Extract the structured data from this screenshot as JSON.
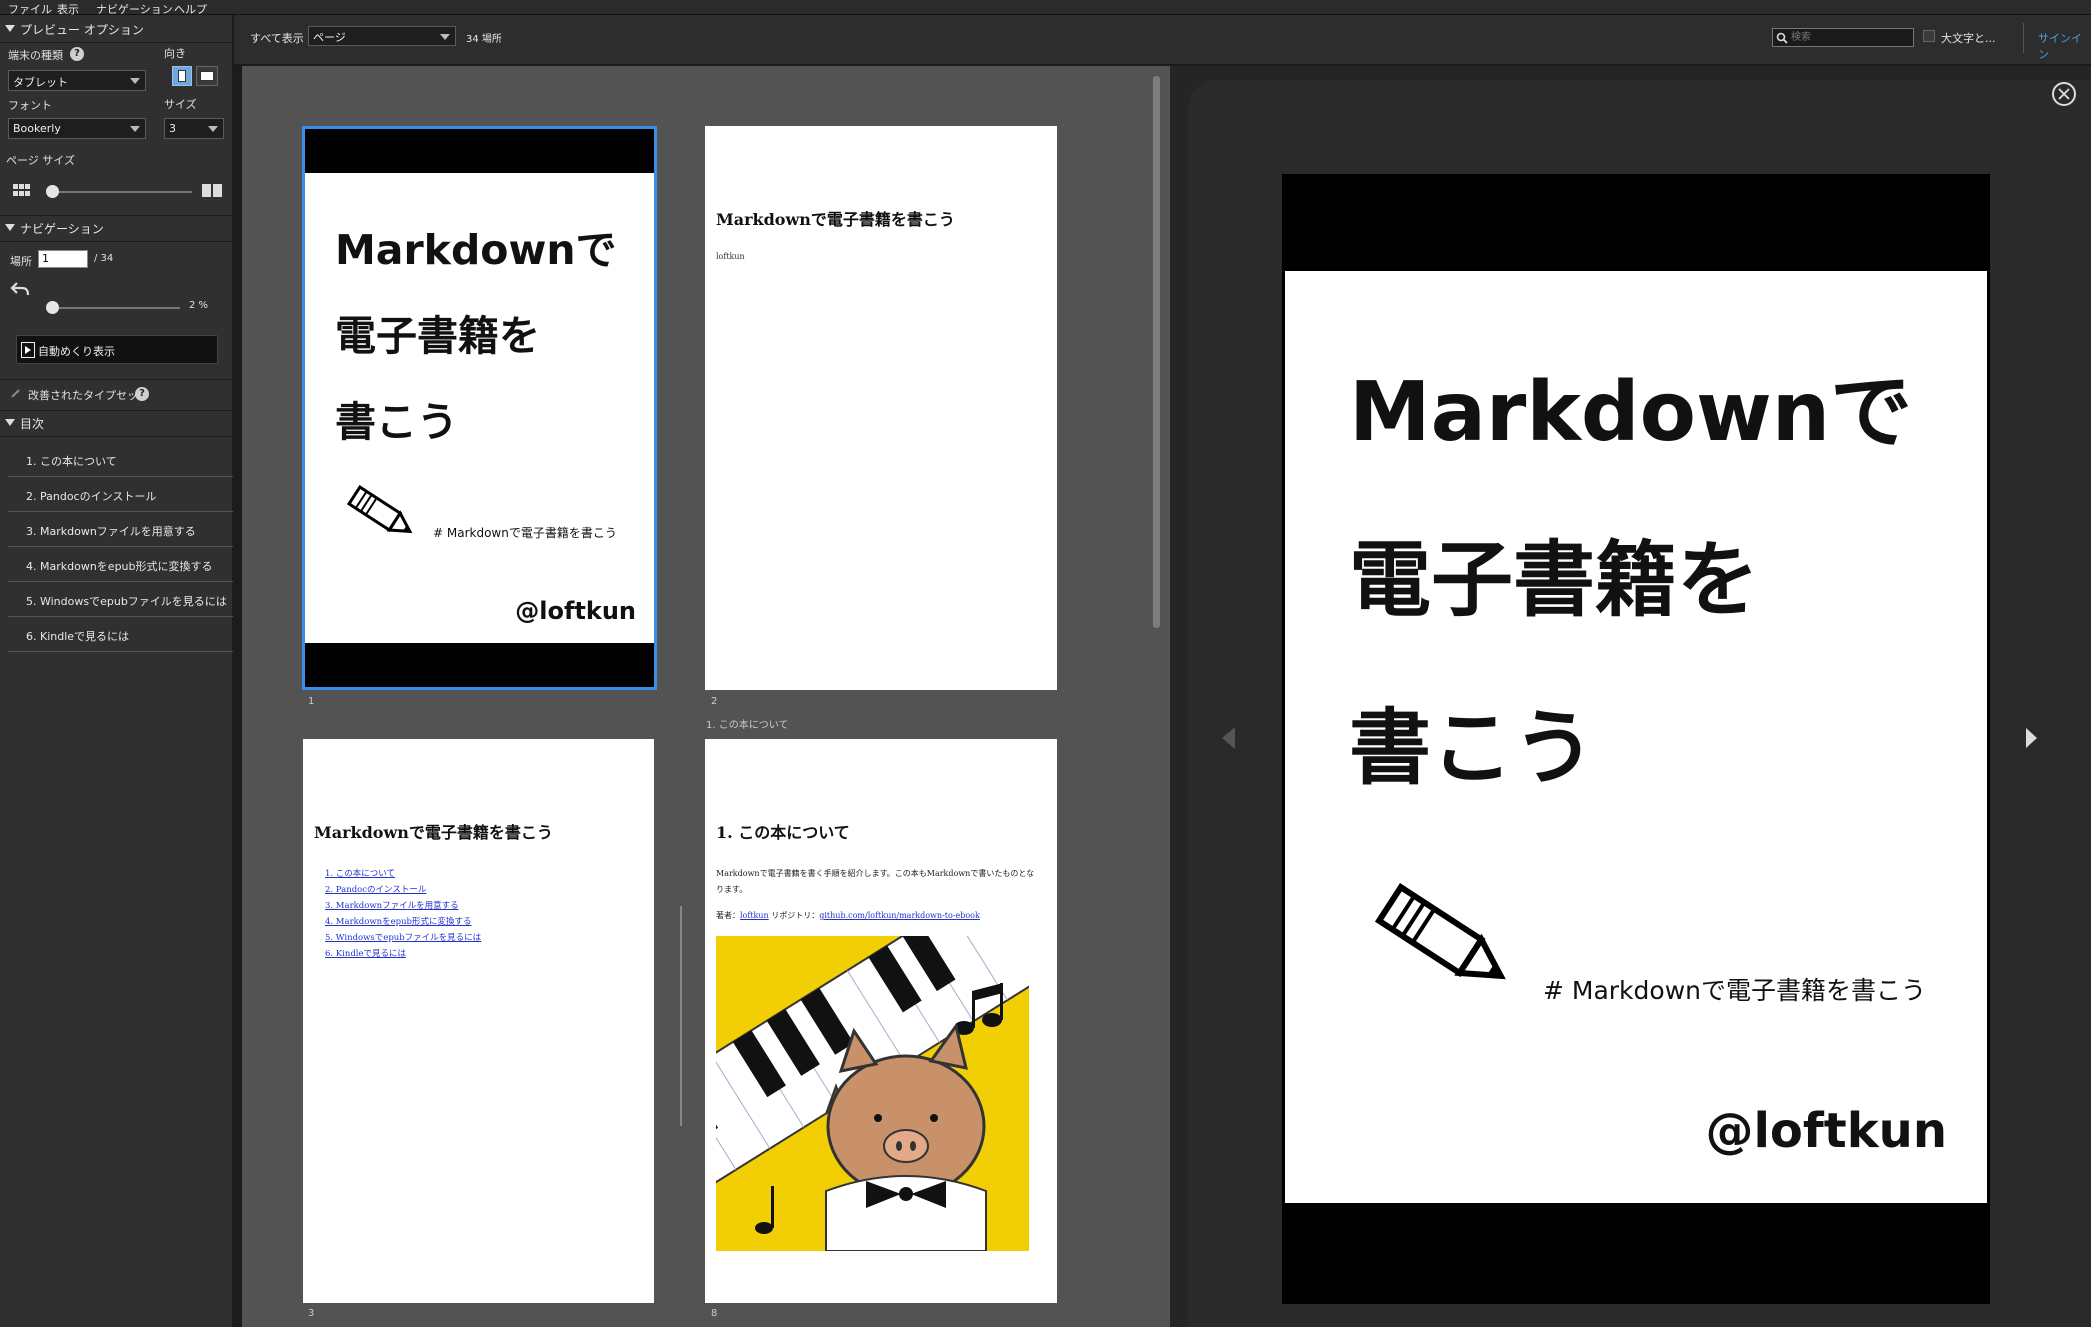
{
  "menu": {
    "file": "ファイル",
    "view": "表示",
    "navigation": "ナビゲーション",
    "help": "ヘルプ"
  },
  "sidebar": {
    "preview_options": "プレビュー オプション",
    "device_type_label": "端末の種類",
    "device_type_value": "タブレット",
    "orientation_label": "向き",
    "font_label": "フォント",
    "font_value": "Bookerly",
    "size_label": "サイズ",
    "size_value": "3",
    "page_size_label": "ページ サイズ",
    "navigation_header": "ナビゲーション",
    "location_label": "場所",
    "location_value": "1",
    "location_total": "/ 34",
    "progress_percent": "2 %",
    "progress_fraction": 0.03,
    "auto_page_turn": "自動めくり表示",
    "enhanced_typesetting": "改善されたタイプセット",
    "toc_header": "目次",
    "toc_items": [
      "1. この本について",
      "2. Pandocのインストール",
      "3. Markdownファイルを用意する",
      "4. Markdownをepub形式に変換する",
      "5. Windowsでepubファイルを見るには",
      "6. Kindleで見るには"
    ]
  },
  "toolbar": {
    "show_all": "すべて表示",
    "view_select": "ページ",
    "location_count": "34 場所",
    "search_placeholder": "検索",
    "case_sensitive": "大文字と...",
    "sign_in": "サインイン"
  },
  "pages": {
    "cover": {
      "title_line1": "Markdownで",
      "title_line2": "電子書籍を",
      "title_line3": "書こう",
      "hashtag": "# Markdownで電子書籍を書こう",
      "author": "@loftkun",
      "number": "1"
    },
    "title_page": {
      "title": "Markdownで電子書籍を書こう",
      "author": "loftkun",
      "number": "2",
      "section": "1. この本について"
    },
    "toc_page": {
      "title": "Markdownで電子書籍を書こう",
      "links": [
        "1. この本について",
        "2. Pandocのインストール",
        "3. Markdownファイルを用意する",
        "4. Markdownをepub形式に変換する",
        "5. Windowsでepubファイルを見るには",
        "6. Kindleで見るには"
      ],
      "number": "3"
    },
    "chapter_page": {
      "heading": "1. この本について",
      "body": "Markdownで電子書籍を書く手順を紹介します。この本もMarkdownで書いたものとなります。",
      "author_label": "著者：",
      "author_link": "loftkun",
      "repo_label": " リポジトリ：",
      "repo_link": "github.com/loftkun/markdown-to-ebook",
      "number": "8"
    }
  },
  "colors": {
    "selection": "#3a8ee6",
    "illustration_bg": "#f2cf05",
    "sign_in": "#4a9fe0"
  }
}
